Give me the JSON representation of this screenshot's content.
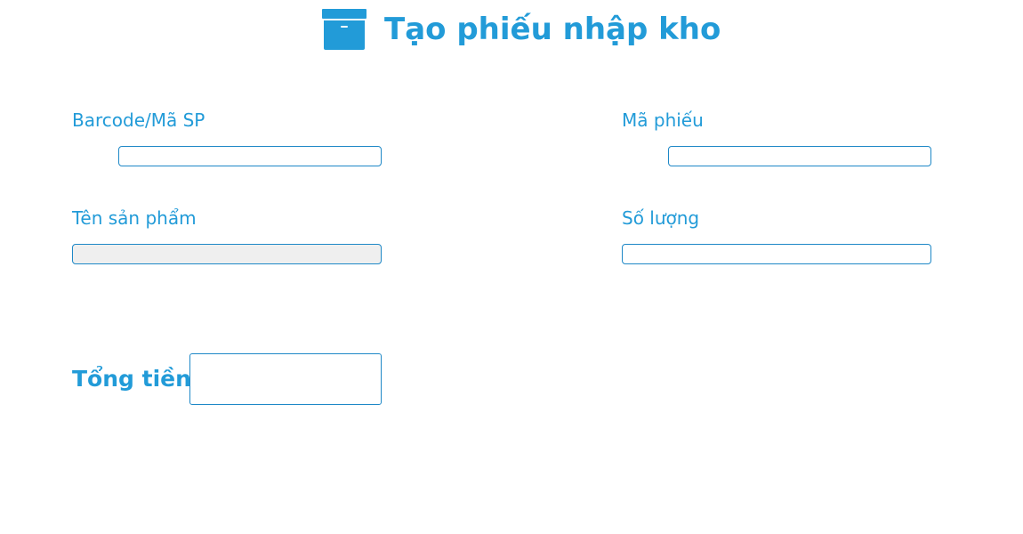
{
  "header": {
    "title": "Tạo phiếu nhập kho",
    "icon": "archive-box-icon",
    "accent_color": "#229bd8"
  },
  "form": {
    "barcode": {
      "label": "Barcode/Mã SP",
      "value": "",
      "placeholder": ""
    },
    "receipt_code": {
      "label": "Mã phiếu",
      "value": "",
      "placeholder": ""
    },
    "product_name": {
      "label": "Tên sản phẩm",
      "value": "",
      "placeholder": ""
    },
    "quantity": {
      "label": "Số lượng",
      "value": "",
      "placeholder": ""
    }
  },
  "total": {
    "label": "Tổng tiền",
    "value": ""
  }
}
